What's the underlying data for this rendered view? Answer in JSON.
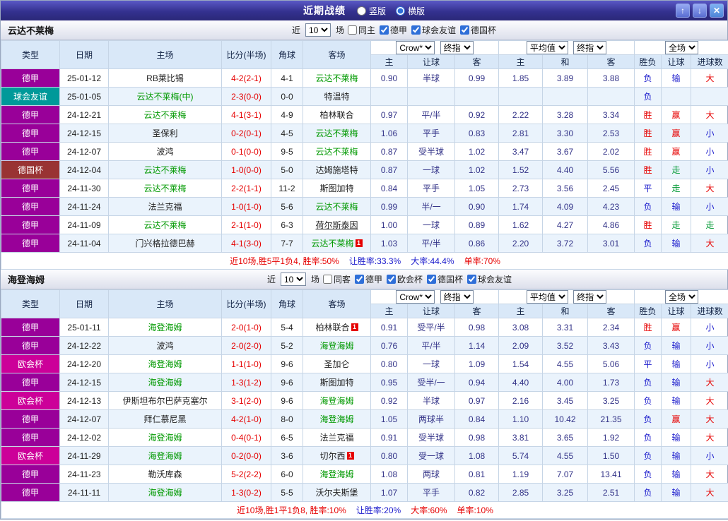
{
  "titlebar": {
    "title": "近期战绩",
    "radios": [
      {
        "label": "竖版",
        "selected": false
      },
      {
        "label": "横版",
        "selected": true
      }
    ],
    "buttons": {
      "up": "↑",
      "down": "↓",
      "close": "✕"
    }
  },
  "league_colors": {
    "德甲": "#990099",
    "球会友谊": "#009999",
    "德国杯": "#993333",
    "欧会杯": "#cc0099"
  },
  "value_colors": {
    "胜": "#e60000",
    "平": "#1a1acc",
    "负": "#1a1acc",
    "赢": "#e60000",
    "输": "#1a1acc",
    "走": "#009933",
    "大": "#e60000",
    "小": "#1a1acc"
  },
  "team_green": "#009900",
  "sections": [
    {
      "team": "云达不莱梅",
      "filter": {
        "near_label": "近",
        "near_value": "10",
        "unit_label": "场",
        "checkboxes": [
          {
            "label": "同主",
            "checked": false
          },
          {
            "label": "德甲",
            "checked": true
          },
          {
            "label": "球会友谊",
            "checked": true
          },
          {
            "label": "德国杯",
            "checked": true
          }
        ]
      },
      "columns": {
        "type": "类型",
        "date": "日期",
        "home": "主场",
        "score": "比分(半场)",
        "corner": "角球",
        "away": "客场",
        "sub": [
          "主",
          "让球",
          "客",
          "主",
          "和",
          "客",
          "胜负",
          "让球",
          "进球数"
        ]
      },
      "selects": {
        "odds1_a": "Crow*",
        "odds1_b": "终指",
        "odds2_a": "平均值",
        "odds2_b": "终指",
        "scope": "全场"
      },
      "rows": [
        {
          "league": "德甲",
          "date": "25-01-12",
          "home": {
            "name": "RB莱比锡"
          },
          "score": "4-2(2-1)",
          "corner": "4-1",
          "away": {
            "name": "云达不莱梅",
            "green": true
          },
          "odds": [
            "0.90",
            "半球",
            "0.99",
            "1.85",
            "3.89",
            "3.88"
          ],
          "result": "负",
          "handicap": "输",
          "goals": "大"
        },
        {
          "league": "球会友谊",
          "date": "25-01-05",
          "home": {
            "name": "云达不莱梅(中)",
            "green": true
          },
          "score": "2-3(0-0)",
          "corner": "0-0",
          "away": {
            "name": "特温特"
          },
          "odds": [
            "",
            "",
            "",
            "",
            "",
            ""
          ],
          "result": "负",
          "handicap": "",
          "goals": ""
        },
        {
          "league": "德甲",
          "date": "24-12-21",
          "home": {
            "name": "云达不莱梅",
            "green": true
          },
          "score": "4-1(3-1)",
          "corner": "4-9",
          "away": {
            "name": "柏林联合"
          },
          "odds": [
            "0.97",
            "平/半",
            "0.92",
            "2.22",
            "3.28",
            "3.34"
          ],
          "result": "胜",
          "handicap": "赢",
          "goals": "大"
        },
        {
          "league": "德甲",
          "date": "24-12-15",
          "home": {
            "name": "圣保利"
          },
          "score": "0-2(0-1)",
          "corner": "4-5",
          "away": {
            "name": "云达不莱梅",
            "green": true
          },
          "odds": [
            "1.06",
            "平手",
            "0.83",
            "2.81",
            "3.30",
            "2.53"
          ],
          "result": "胜",
          "handicap": "赢",
          "goals": "小"
        },
        {
          "league": "德甲",
          "date": "24-12-07",
          "home": {
            "name": "波鸿"
          },
          "score": "0-1(0-0)",
          "corner": "9-5",
          "away": {
            "name": "云达不莱梅",
            "green": true
          },
          "odds": [
            "0.87",
            "受半球",
            "1.02",
            "3.47",
            "3.67",
            "2.02"
          ],
          "result": "胜",
          "handicap": "赢",
          "goals": "小"
        },
        {
          "league": "德国杯",
          "date": "24-12-04",
          "home": {
            "name": "云达不莱梅",
            "green": true
          },
          "score": "1-0(0-0)",
          "corner": "5-0",
          "away": {
            "name": "达姆施塔特"
          },
          "odds": [
            "0.87",
            "一球",
            "1.02",
            "1.52",
            "4.40",
            "5.56"
          ],
          "result": "胜",
          "handicap": "走",
          "goals": "小"
        },
        {
          "league": "德甲",
          "date": "24-11-30",
          "home": {
            "name": "云达不莱梅",
            "green": true
          },
          "score": "2-2(1-1)",
          "corner": "11-2",
          "away": {
            "name": "斯图加特"
          },
          "odds": [
            "0.84",
            "平手",
            "1.05",
            "2.73",
            "3.56",
            "2.45"
          ],
          "result": "平",
          "handicap": "走",
          "goals": "大"
        },
        {
          "league": "德甲",
          "date": "24-11-24",
          "home": {
            "name": "法兰克福"
          },
          "score": "1-0(1-0)",
          "corner": "5-6",
          "away": {
            "name": "云达不莱梅",
            "green": true
          },
          "odds": [
            "0.99",
            "半/一",
            "0.90",
            "1.74",
            "4.09",
            "4.23"
          ],
          "result": "负",
          "handicap": "输",
          "goals": "小"
        },
        {
          "league": "德甲",
          "date": "24-11-09",
          "home": {
            "name": "云达不莱梅",
            "green": true
          },
          "score": "2-1(1-0)",
          "corner": "6-3",
          "away": {
            "name": "荷尔斯泰因",
            "underline": true
          },
          "odds": [
            "1.00",
            "一球",
            "0.89",
            "1.62",
            "4.27",
            "4.86"
          ],
          "result": "胜",
          "handicap": "走",
          "goals": "走"
        },
        {
          "league": "德甲",
          "date": "24-11-04",
          "home": {
            "name": "门兴格拉德巴赫"
          },
          "score": "4-1(3-0)",
          "corner": "7-7",
          "away": {
            "name": "云达不莱梅",
            "green": true,
            "badge": "1"
          },
          "odds": [
            "1.03",
            "平/半",
            "0.86",
            "2.20",
            "3.72",
            "3.01"
          ],
          "result": "负",
          "handicap": "输",
          "goals": "大"
        }
      ],
      "summary": [
        {
          "text": "近10场,胜5平1负4, 胜率:50%",
          "color": "#e60000"
        },
        {
          "text": "让胜率:33.3%",
          "color": "#1a1acc"
        },
        {
          "text": "大率:44.4%",
          "color": "#1a1acc"
        },
        {
          "text": "单率:70%",
          "color": "#e60000"
        }
      ]
    },
    {
      "team": "海登海姆",
      "filter": {
        "near_label": "近",
        "near_value": "10",
        "unit_label": "场",
        "checkboxes": [
          {
            "label": "同客",
            "checked": false
          },
          {
            "label": "德甲",
            "checked": true
          },
          {
            "label": "欧会杯",
            "checked": true
          },
          {
            "label": "德国杯",
            "checked": true
          },
          {
            "label": "球会友谊",
            "checked": true
          }
        ]
      },
      "columns": {
        "type": "类型",
        "date": "日期",
        "home": "主场",
        "score": "比分(半场)",
        "corner": "角球",
        "away": "客场",
        "sub": [
          "主",
          "让球",
          "客",
          "主",
          "和",
          "客",
          "胜负",
          "让球",
          "进球数"
        ]
      },
      "selects": {
        "odds1_a": "Crow*",
        "odds1_b": "终指",
        "odds2_a": "平均值",
        "odds2_b": "终指",
        "scope": "全场"
      },
      "rows": [
        {
          "league": "德甲",
          "date": "25-01-11",
          "home": {
            "name": "海登海姆",
            "green": true
          },
          "score": "2-0(1-0)",
          "corner": "5-4",
          "away": {
            "name": "柏林联合",
            "badge": "1"
          },
          "odds": [
            "0.91",
            "受平/半",
            "0.98",
            "3.08",
            "3.31",
            "2.34"
          ],
          "result": "胜",
          "handicap": "赢",
          "goals": "小"
        },
        {
          "league": "德甲",
          "date": "24-12-22",
          "home": {
            "name": "波鸿"
          },
          "score": "2-0(2-0)",
          "corner": "5-2",
          "away": {
            "name": "海登海姆",
            "green": true
          },
          "odds": [
            "0.76",
            "平/半",
            "1.14",
            "2.09",
            "3.52",
            "3.43"
          ],
          "result": "负",
          "handicap": "输",
          "goals": "小"
        },
        {
          "league": "欧会杯",
          "date": "24-12-20",
          "home": {
            "name": "海登海姆",
            "green": true
          },
          "score": "1-1(1-0)",
          "corner": "9-6",
          "away": {
            "name": "圣加仑"
          },
          "odds": [
            "0.80",
            "一球",
            "1.09",
            "1.54",
            "4.55",
            "5.06"
          ],
          "result": "平",
          "handicap": "输",
          "goals": "小"
        },
        {
          "league": "德甲",
          "date": "24-12-15",
          "home": {
            "name": "海登海姆",
            "green": true
          },
          "score": "1-3(1-2)",
          "corner": "9-6",
          "away": {
            "name": "斯图加特"
          },
          "odds": [
            "0.95",
            "受半/一",
            "0.94",
            "4.40",
            "4.00",
            "1.73"
          ],
          "result": "负",
          "handicap": "输",
          "goals": "大"
        },
        {
          "league": "欧会杯",
          "date": "24-12-13",
          "home": {
            "name": "伊斯坦布尔巴萨克塞尔"
          },
          "score": "3-1(2-0)",
          "corner": "9-6",
          "away": {
            "name": "海登海姆",
            "green": true
          },
          "odds": [
            "0.92",
            "半球",
            "0.97",
            "2.16",
            "3.45",
            "3.25"
          ],
          "result": "负",
          "handicap": "输",
          "goals": "大"
        },
        {
          "league": "德甲",
          "date": "24-12-07",
          "home": {
            "name": "拜仁慕尼黑"
          },
          "score": "4-2(1-0)",
          "corner": "8-0",
          "away": {
            "name": "海登海姆",
            "green": true
          },
          "odds": [
            "1.05",
            "两球半",
            "0.84",
            "1.10",
            "10.42",
            "21.35"
          ],
          "result": "负",
          "handicap": "赢",
          "goals": "大"
        },
        {
          "league": "德甲",
          "date": "24-12-02",
          "home": {
            "name": "海登海姆",
            "green": true
          },
          "score": "0-4(0-1)",
          "corner": "6-5",
          "away": {
            "name": "法兰克福"
          },
          "odds": [
            "0.91",
            "受半球",
            "0.98",
            "3.81",
            "3.65",
            "1.92"
          ],
          "result": "负",
          "handicap": "输",
          "goals": "大"
        },
        {
          "league": "欧会杯",
          "date": "24-11-29",
          "home": {
            "name": "海登海姆",
            "green": true
          },
          "score": "0-2(0-0)",
          "corner": "3-6",
          "away": {
            "name": "切尔西",
            "badge": "1"
          },
          "odds": [
            "0.80",
            "受一球",
            "1.08",
            "5.74",
            "4.55",
            "1.50"
          ],
          "result": "负",
          "handicap": "输",
          "goals": "小"
        },
        {
          "league": "德甲",
          "date": "24-11-23",
          "home": {
            "name": "勒沃库森"
          },
          "score": "5-2(2-2)",
          "corner": "6-0",
          "away": {
            "name": "海登海姆",
            "green": true
          },
          "odds": [
            "1.08",
            "两球",
            "0.81",
            "1.19",
            "7.07",
            "13.41"
          ],
          "result": "负",
          "handicap": "输",
          "goals": "大"
        },
        {
          "league": "德甲",
          "date": "24-11-11",
          "home": {
            "name": "海登海姆",
            "green": true
          },
          "score": "1-3(0-2)",
          "corner": "5-5",
          "away": {
            "name": "沃尔夫斯堡"
          },
          "odds": [
            "1.07",
            "平手",
            "0.82",
            "2.85",
            "3.25",
            "2.51"
          ],
          "result": "负",
          "handicap": "输",
          "goals": "大"
        }
      ],
      "summary": [
        {
          "text": "近10场,胜1平1负8, 胜率:10%",
          "color": "#e60000"
        },
        {
          "text": "让胜率:20%",
          "color": "#1a1acc"
        },
        {
          "text": "大率:60%",
          "color": "#e60000"
        },
        {
          "text": "单率:10%",
          "color": "#e60000"
        }
      ]
    }
  ]
}
